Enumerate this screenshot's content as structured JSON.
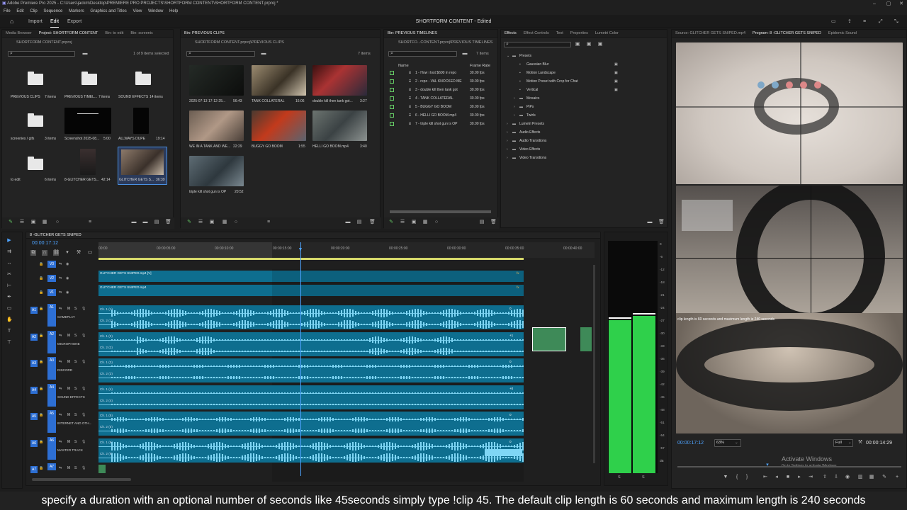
{
  "app": {
    "title": "Adobe Premiere Pro 2025 - C:\\Users\\jackm\\Desktop\\PREMIERE PRO PROJECTS\\SHORTFORM CONTENT\\SHORTFORM CONTENT.prproj *",
    "menu": [
      "File",
      "Edit",
      "Clip",
      "Sequence",
      "Markers",
      "Graphics and Titles",
      "View",
      "Window",
      "Help"
    ],
    "workspaces": [
      "Import",
      "Edit",
      "Export"
    ],
    "project_name": "SHORTFORM CONTENT - Edited"
  },
  "project_panel": {
    "tabs": [
      "Media Browser",
      "Project: SHORTFORM CONTENT",
      "Bin: to edit",
      "Bin: screenic"
    ],
    "file": "SHORTFORM CONTENT.prproj",
    "selection": "1 of 9 items selected",
    "items": [
      {
        "name": "PREVIOUS CLIPS",
        "count": "7 items"
      },
      {
        "name": "PREVIOUS TIMEL...",
        "count": "7 items"
      },
      {
        "name": "SOUND EFFECTS",
        "count": "14 items"
      },
      {
        "name": "screenies / gifs",
        "count": "3 items"
      },
      {
        "name": "Screenshot 2025-08...",
        "count": "5:00"
      },
      {
        "name": "ALLWAYS DUPE",
        "count": "19:14"
      },
      {
        "name": "to edit",
        "count": "6 items"
      },
      {
        "name": "8-GLITCHER GETS...",
        "count": "42:14"
      },
      {
        "name": "GLITCHER GETS S...",
        "count": "36:39"
      }
    ]
  },
  "clips_panel": {
    "tab": "Bin: PREVIOUS CLIPS",
    "path": "SHORTFORM CONTENT.prproj\\PREVIOUS CLIPS",
    "count": "7 items",
    "items": [
      {
        "name": "2025-07-13 17-12-25...",
        "dur": "56:43"
      },
      {
        "name": "TANK COLLATERAL",
        "dur": "16:06"
      },
      {
        "name": "double kill then tank got...",
        "dur": "3:27"
      },
      {
        "name": "WE IN A TANK AND WE...",
        "dur": "22:29"
      },
      {
        "name": "BUGGY GO BOOM",
        "dur": "1:55"
      },
      {
        "name": "HELLI GO BOOM.mp4",
        "dur": "3:40"
      },
      {
        "name": "triple kill shot gun is OP",
        "dur": "20:52"
      }
    ]
  },
  "timelines_panel": {
    "tab": "Bin: PREVIOUS TIMELINES",
    "path": "SHORTFO...CONTENT.prproj\\PREVIOUS TIMELINES",
    "count": "7 items",
    "col_name": "Name",
    "col_rate": "Frame Rate",
    "items": [
      {
        "name": "1 - How i lost $600 in repo",
        "rate": "30.00 fps"
      },
      {
        "name": "2 - repo - VAL KNOCKED ME",
        "rate": "30.00 fps"
      },
      {
        "name": "3 - double kill then tank got",
        "rate": "30.00 fps"
      },
      {
        "name": "4 - TANK COLLATERAL",
        "rate": "30.00 fps"
      },
      {
        "name": "5 - BUGGY GO BOOM",
        "rate": "30.00 fps"
      },
      {
        "name": "6 - HELLI GO BOOM.mp4",
        "rate": "30.00 fps"
      },
      {
        "name": "7 - triple kill shot gun is OP",
        "rate": "30.00 fps"
      }
    ]
  },
  "effects_panel": {
    "tabs": [
      "Effects",
      "Effect Controls",
      "Text",
      "Properties",
      "Lumetri Color"
    ],
    "items": [
      {
        "name": "Presets",
        "level": 0,
        "open": true
      },
      {
        "name": "Gaussian Blur",
        "level": 1
      },
      {
        "name": "Motion Landscape",
        "level": 1
      },
      {
        "name": "Motion Preset with Crop for Chat",
        "level": 1
      },
      {
        "name": "Vertical",
        "level": 1
      },
      {
        "name": "Mosaics",
        "level": 1,
        "folder": true
      },
      {
        "name": "PiPs",
        "level": 1,
        "folder": true
      },
      {
        "name": "Twirls",
        "level": 1,
        "folder": true
      },
      {
        "name": "Lumetri Presets",
        "level": 0,
        "folder": true
      },
      {
        "name": "Audio Effects",
        "level": 0,
        "folder": true
      },
      {
        "name": "Audio Transitions",
        "level": 0,
        "folder": true
      },
      {
        "name": "Video Effects",
        "level": 0,
        "folder": true
      },
      {
        "name": "Video Transitions",
        "level": 0,
        "folder": true
      }
    ]
  },
  "program_monitor": {
    "tabs": [
      "Source: GLITCHER GETS SNIPED.mp4",
      "Program: 8 -GLITCHER GETS SNIPED",
      "Epidemic Sound"
    ],
    "timecode": "00:00:17:12",
    "zoom": "63%",
    "quality": "Full",
    "duration": "00:00:14:29",
    "overlay": "clip length is 60 seconds and maximum length is 240 seconds",
    "watermark_title": "Activate Windows",
    "watermark_sub": "Go to Settings to activate Windows."
  },
  "timeline": {
    "tab": "8 -GLITCHER GETS SNIPED",
    "timecode": "00:00:17:12",
    "ruler": [
      "00:00",
      "00:00:05:00",
      "00:00:10:00",
      "00:00:15:00",
      "00:00:20:00",
      "00:00:25:00",
      "00:00:30:00",
      "00:00:35:00",
      "00:00:40:00"
    ],
    "video_tracks": [
      {
        "id": "V3",
        "clip": ""
      },
      {
        "id": "V2",
        "clip": "GLITCHER GETS SNIPED.mp4 [V]"
      },
      {
        "id": "V1",
        "clip": "GLITCHER GETS SNIPED.mp4"
      }
    ],
    "audio_tracks": [
      {
        "id": "A1",
        "name": "GAMEPLAY"
      },
      {
        "id": "A2",
        "name": "MICROPHONE"
      },
      {
        "id": "A3",
        "name": "DISCORD"
      },
      {
        "id": "A4",
        "name": "SOUND EFFECTS"
      },
      {
        "id": "A5",
        "name": "INTERNET AND OTH..."
      },
      {
        "id": "A6",
        "name": "MASTER TRACK"
      },
      {
        "id": "A7",
        "name": ""
      }
    ],
    "channel_labels": [
      "Ch. 1 (1)",
      "Ch. 2 (1)",
      "Ch. 1 (2)",
      "Ch. 2 (2)",
      "Ch. 1 (3)",
      "Ch. 2 (3)",
      "Ch. 1 (4)",
      "Ch. 2 (4)",
      "Ch. 1 (5)",
      "Ch. 2 (5)",
      "Ch. 1 (6)",
      "Ch. 2 (6)"
    ],
    "gain_labels": [
      "0",
      "+1",
      "0",
      "+0",
      "0",
      "0"
    ]
  },
  "audio_meter": {
    "scale": [
      "0",
      "-6",
      "-12",
      "-18",
      "-21",
      "-24",
      "-27",
      "-30",
      "-33",
      "-36",
      "-39",
      "-42",
      "-45",
      "-48",
      "-51",
      "-54",
      "-57",
      "dB"
    ],
    "labels": [
      "S",
      "S"
    ],
    "levels": [
      0.72,
      0.74
    ]
  },
  "caption": "specify a duration with an optional number of seconds like 45seconds simply type !clip 45. The default clip length is 60 seconds and maximum length is 240 seconds",
  "colors": {
    "clip": "#0e6e8f",
    "waveform": "#7fd6f5",
    "meter": "#2fd04b",
    "accent": "#2d8ceb"
  }
}
